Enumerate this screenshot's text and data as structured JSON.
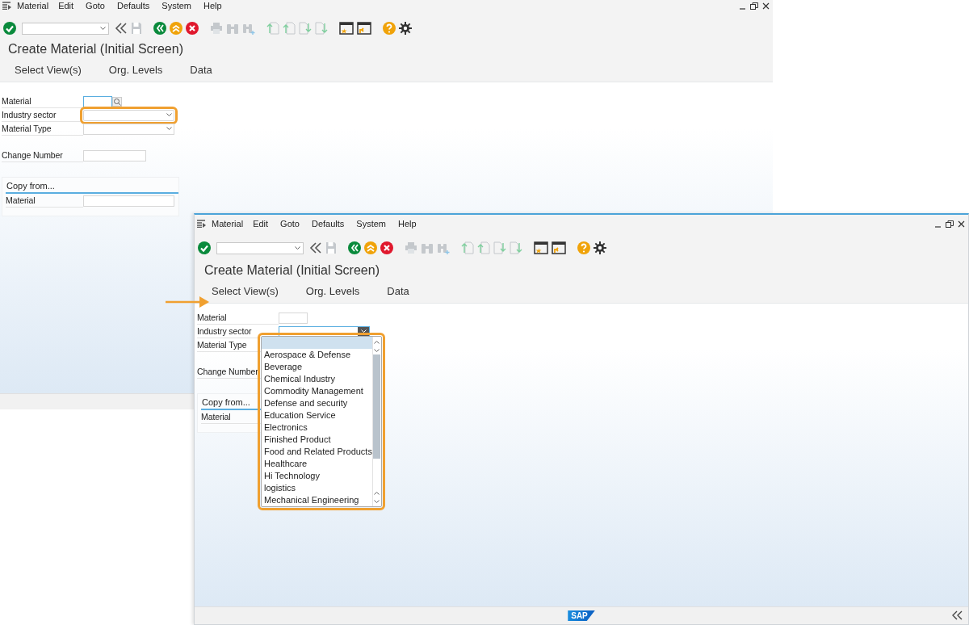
{
  "windows": [
    {
      "menu": [
        "Material",
        "Edit",
        "Goto",
        "Defaults",
        "System",
        "Help"
      ],
      "title": "Create Material (Initial Screen)",
      "actions": [
        "Select View(s)",
        "Org. Levels",
        "Data"
      ],
      "fields": [
        {
          "label": "Material",
          "kind": "search",
          "focused": true
        },
        {
          "label": "Industry sector",
          "kind": "dropdown",
          "highlighted": true
        },
        {
          "label": "Material Type",
          "kind": "dropdown"
        },
        {
          "label": "Change Number",
          "kind": "text"
        }
      ],
      "copy_from": {
        "title": "Copy from...",
        "fields": [
          {
            "label": "Material",
            "kind": "wide"
          }
        ]
      }
    },
    {
      "menu": [
        "Material",
        "Edit",
        "Goto",
        "Defaults",
        "System",
        "Help"
      ],
      "title": "Create Material (Initial Screen)",
      "actions": [
        "Select View(s)",
        "Org. Levels",
        "Data"
      ],
      "pointer_arrow": true,
      "fields": [
        {
          "label": "Material",
          "kind": "text"
        },
        {
          "label": "Industry sector",
          "kind": "open-dropdown",
          "focused": true
        },
        {
          "label": "Material Type",
          "kind": "covered"
        },
        {
          "label": "Change Number",
          "kind": "covered"
        }
      ],
      "copy_from": {
        "title": "Copy from...",
        "fields": [
          {
            "label": "Material",
            "kind": "covered"
          }
        ]
      },
      "dropdown_list": {
        "highlighted": true,
        "items": [
          "Aerospace & Defense",
          "Beverage",
          "Chemical Industry",
          "Commodity Management",
          "Defense and security",
          "Education Service",
          "Electronics",
          "Finished Product",
          "Food and Related Products",
          "Healthcare",
          "Hi Technology",
          "logistics",
          "Mechanical Engineering"
        ]
      },
      "status_bar": {
        "logo": "SAP"
      }
    }
  ]
}
